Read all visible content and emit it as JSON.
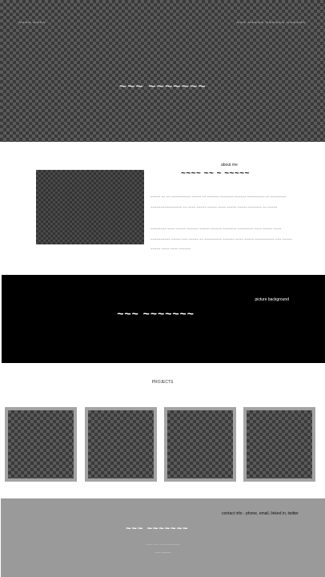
{
  "hero": {
    "logo": "~~~~ ~~~~",
    "nav": "~~~ ~~~~~ ~~~~~~ ~~~~~~",
    "title": "~~~ ~~~~~~~"
  },
  "about": {
    "kicker": "about me",
    "heading": "~~~~ ~~ ~ ~~~~~",
    "paragraph1": "~~~~~ ~~ ~~ ~~~~~~~~~~ ~~~~~ ~~ ~~~~~~ ~~~~~~~ ~~~~~~ ~~~~~~~~~ ~~ ~~~~~~~~ ~~~~~~~~~~~~~~~~ ~~ ~~~~ ~~~~~ ~~~~~ ~~~~ ~~~~~ ~~~~~ ~~~~~~~ ~~ ~~~~~",
    "paragraph2": "~~~~~~~~ ~~~~ ~~~~~ ~~~~~~ ~~~~~ ~~~~~~ ~~~~~~~ ~~~~~~~~ ~~~~ ~~~~~ ~~~~ ~~~~~~~~~~ ~~~~~ ~~~ ~~~~~ ~~ ~~~~~~~~~ ~~~~~~ ~~~~ ~~~~~ ~~~~~~~~~~ ~~~ ~~~~~ ~~~~~ ~~~~ ~~~~ ~~~~~~"
  },
  "band": {
    "caption": "picture background",
    "title": "~~~ ~~~~~~~"
  },
  "projects": {
    "heading": "PROJECTS"
  },
  "footer": {
    "contact": "contact info - phone, email, linked in, twitter",
    "title": "~~~ ~~~~~~~",
    "small1": "~~~~ ~~~ · ~~~~~~~~~~~~",
    "small2": "~~~ ~~~~~"
  }
}
